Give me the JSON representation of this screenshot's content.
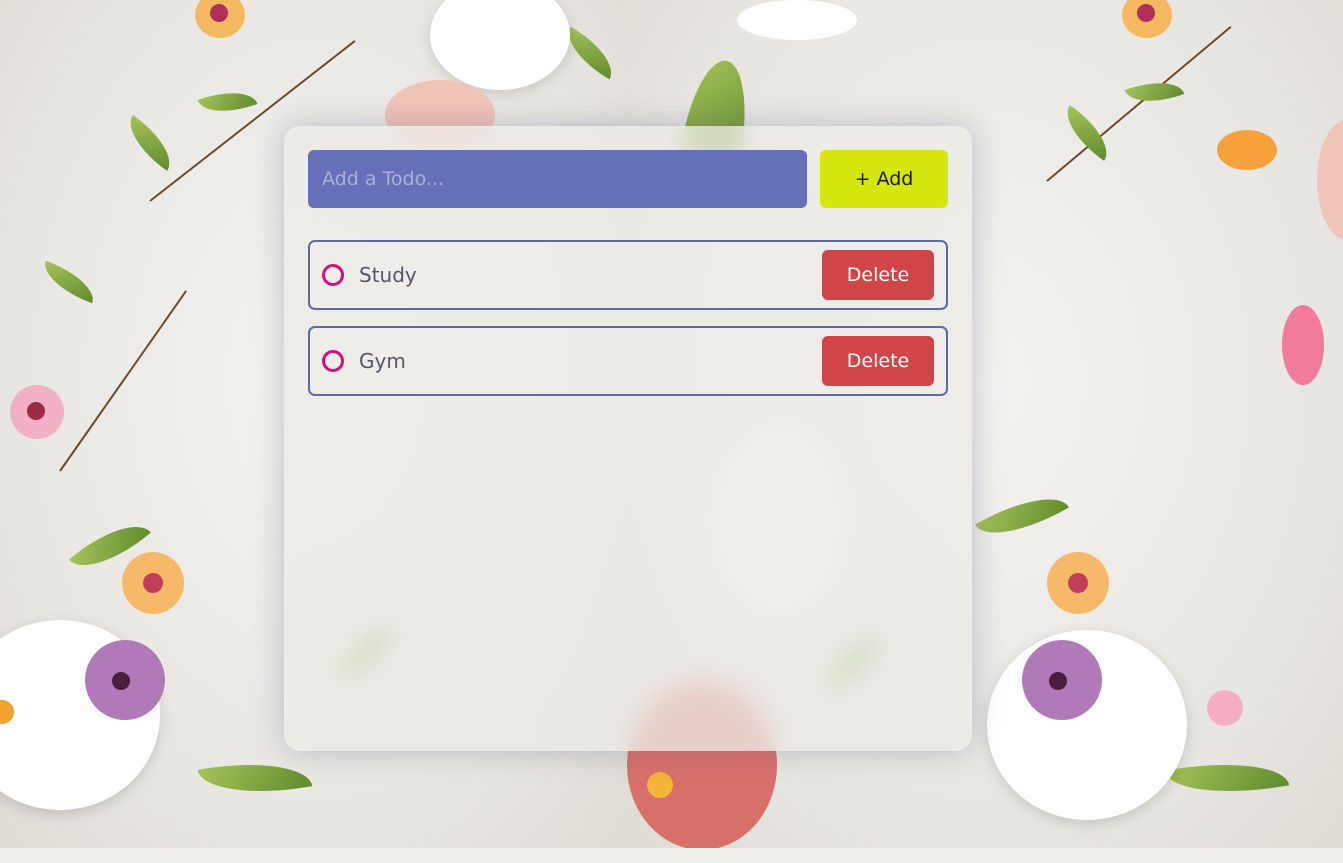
{
  "input": {
    "placeholder": "Add a Todo...",
    "value": ""
  },
  "add_button": {
    "label": "+ Add"
  },
  "todos": [
    {
      "text": "Study",
      "completed": false,
      "delete_label": "Delete"
    },
    {
      "text": "Gym",
      "completed": false,
      "delete_label": "Delete"
    }
  ],
  "colors": {
    "input_bg": "#6670b8",
    "add_button_bg": "#d6e60e",
    "delete_button_bg": "#d04547",
    "check_ring": "#d0117d",
    "item_border": "#5e68a8"
  }
}
